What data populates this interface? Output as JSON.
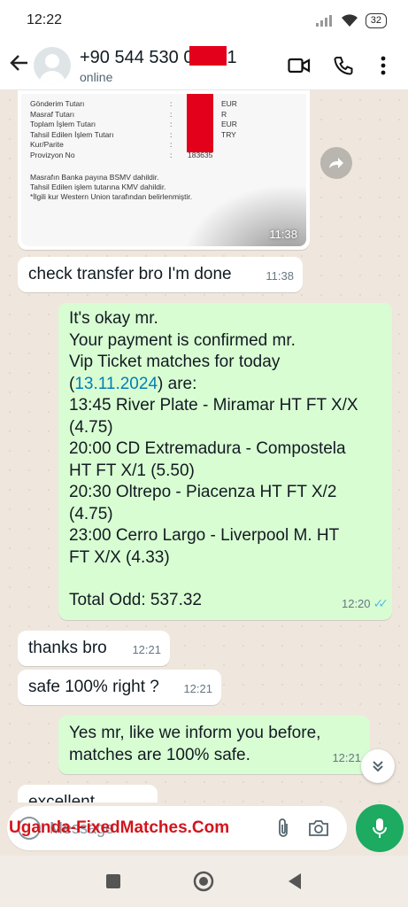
{
  "status_bar": {
    "time": "12:22",
    "battery": "32"
  },
  "header": {
    "back_icon": "arrow-left-icon",
    "contact_phone": "+90 544 530 0",
    "contact_phone_tail": "1",
    "contact_status": "online",
    "icons": [
      "video-call-icon",
      "voice-call-icon",
      "more-vertical-icon"
    ]
  },
  "receipt": {
    "rows": [
      {
        "label": "Gönderim Tutarı",
        "sep": ":",
        "value": "EUR"
      },
      {
        "label": "Masraf Tutarı",
        "sep": ":",
        "value": "R"
      },
      {
        "label": "Toplam İşlem Tutarı",
        "sep": ":",
        "value": "EUR"
      },
      {
        "label": "Tahsil Edilen İşlem Tutarı",
        "sep": ":",
        "value": "TRY"
      },
      {
        "label": "Kur/Parite",
        "sep": ":",
        "value": ""
      },
      {
        "label": "Provizyon No",
        "sep": ":",
        "value": "183635"
      }
    ],
    "note_1": "Masrafın Banka payına BSMV dahildir.",
    "note_2": "Tahsil Edilen işlem tutarına KMV dahildir.",
    "note_3": "*İlgili kur Western Union tarafından belirlenmiştir.",
    "time": "11:38"
  },
  "messages": {
    "m1": {
      "text": "check transfer bro I'm done",
      "time": "11:38"
    },
    "m2": {
      "lines": [
        "It's okay mr.",
        "Your payment is confirmed mr.",
        "Vip Ticket matches for today",
        "13:45 River Plate - Miramar HT FT X/X",
        "(4.75)",
        "20:00 CD Extremadura - Compostela",
        "HT FT X/1 (5.50)",
        "20:30 Oltrepo - Piacenza HT FT X/2",
        "(4.75)",
        "23:00 Cerro Largo - Liverpool M. HT",
        "FT X/X (4.33)",
        "Total Odd: 537.32"
      ],
      "date_prefix": "(",
      "date_link": "13.11.2024",
      "date_suffix": ") are:",
      "time": "12:20"
    },
    "m3": {
      "text": "thanks bro",
      "time": "12:21"
    },
    "m4": {
      "text": "safe 100% right ?",
      "time": "12:21"
    },
    "m5": {
      "line1": "Yes mr, like we inform you before,",
      "line2": "matches are 100% safe.",
      "time": "12:21"
    },
    "m6": {
      "text": "excellent"
    }
  },
  "input": {
    "placeholder": "Message",
    "watermark": "Uganda-FixedMatches.Com"
  },
  "colors": {
    "outgoing_bubble": "#d9fdd3",
    "incoming_bubble": "#ffffff",
    "accent": "#1daa61",
    "redaction": "#e3001b"
  }
}
